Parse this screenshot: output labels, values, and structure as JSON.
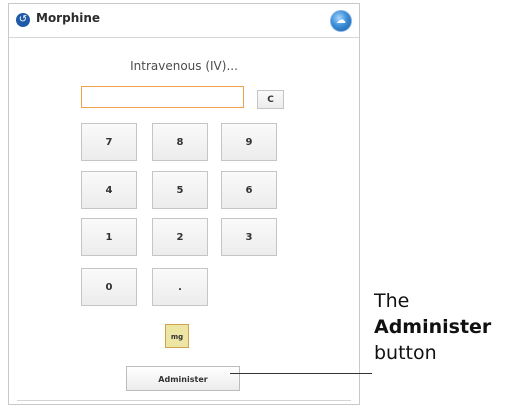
{
  "header": {
    "title": "Morphine",
    "back_icon": "circle-arrow-icon",
    "corner_icon": "brand-globe-icon"
  },
  "route_text": "Intravenous (IV)...",
  "dose_input": {
    "value": "",
    "placeholder": ""
  },
  "keypad": {
    "clear": "C",
    "row1": [
      "7",
      "8",
      "9"
    ],
    "row2": [
      "4",
      "5",
      "6"
    ],
    "row3": [
      "1",
      "2",
      "3"
    ],
    "row4": [
      "0",
      "."
    ]
  },
  "unit_label": "mg",
  "administer_label": "Administer",
  "callout": {
    "line1": "The",
    "line2": "Administer",
    "line3": "button"
  },
  "colors": {
    "input_border": "#f2a14b",
    "unit_bg": "#ece5a3",
    "back_icon": "#1e5aa8"
  }
}
